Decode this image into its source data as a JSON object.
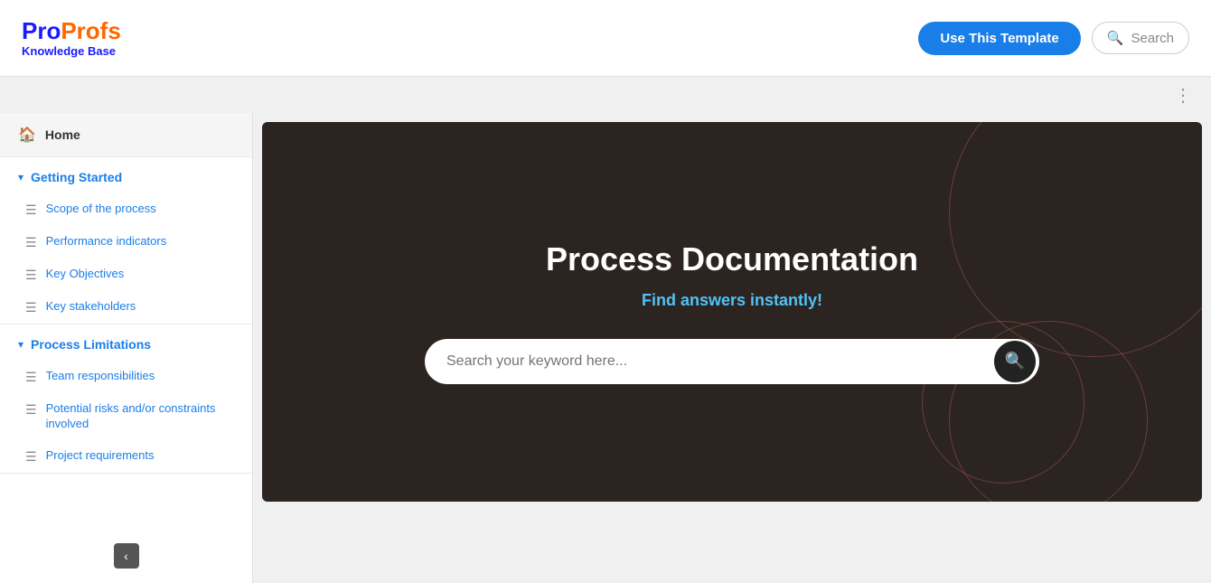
{
  "header": {
    "logo_pro": "Pro",
    "logo_profs": "Profs",
    "logo_subtitle": "Knowledge Base",
    "use_template_label": "Use This Template",
    "search_label": "Search"
  },
  "sidebar": {
    "home_label": "Home",
    "sections": [
      {
        "id": "getting-started",
        "title": "Getting Started",
        "items": [
          {
            "label": "Scope of the process"
          },
          {
            "label": "Performance indicators"
          },
          {
            "label": "Key Objectives"
          },
          {
            "label": "Key stakeholders"
          }
        ]
      },
      {
        "id": "process-limitations",
        "title": "Process Limitations",
        "items": [
          {
            "label": "Team responsibilities"
          },
          {
            "label": "Potential risks and/or constraints involved"
          },
          {
            "label": "Project requirements"
          }
        ]
      }
    ]
  },
  "hero": {
    "title": "Process Documentation",
    "subtitle": "Find answers instantly!",
    "search_placeholder": "Search your keyword here..."
  },
  "dots": "⋮"
}
